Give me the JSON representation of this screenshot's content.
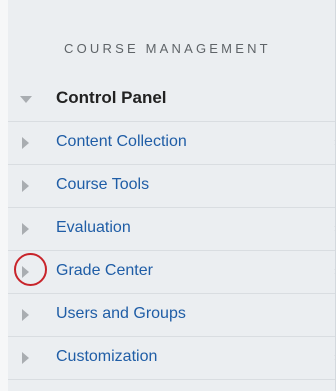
{
  "section_title": "COURSE MANAGEMENT",
  "menu": {
    "header": {
      "label": "Control Panel",
      "icon": "triangle-down-icon"
    },
    "items": [
      {
        "label": "Content Collection",
        "has_chevron": true
      },
      {
        "label": "Course Tools",
        "has_chevron": false
      },
      {
        "label": "Evaluation",
        "has_chevron": true
      },
      {
        "label": "Grade Center",
        "has_chevron": true,
        "highlighted": true
      },
      {
        "label": "Users and Groups",
        "has_chevron": false
      },
      {
        "label": "Customization",
        "has_chevron": true
      }
    ],
    "chevron_glyph": "›"
  },
  "colors": {
    "link": "#1f5da6",
    "header_text": "#222222",
    "highlight": "#c8242b",
    "panel_bg": "#ebeef1"
  }
}
